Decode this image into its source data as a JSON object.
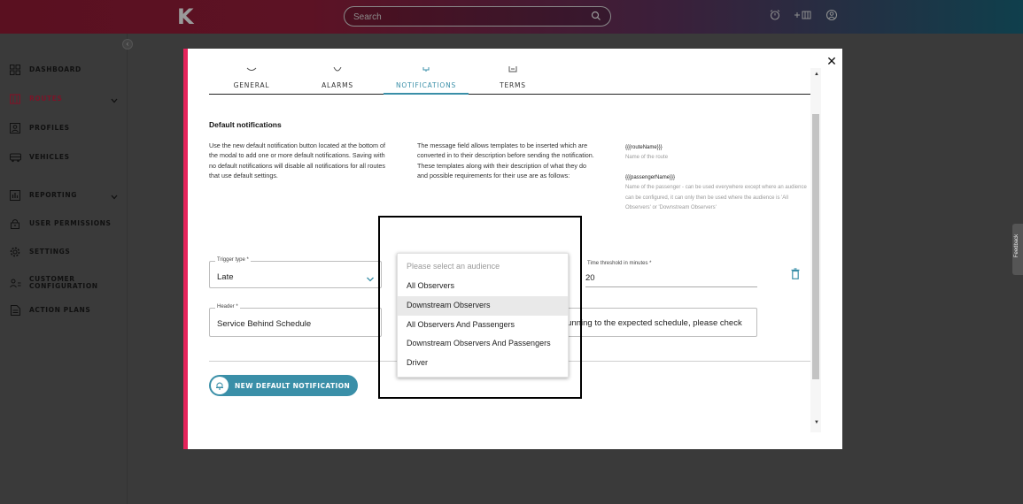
{
  "topbar": {
    "logo_text": "K",
    "search_placeholder": "Search"
  },
  "sidebar": {
    "items": [
      {
        "label": "DASHBOARD",
        "icon": "dashboard-icon"
      },
      {
        "label": "ROUTES",
        "icon": "routes-icon",
        "active": true,
        "expandable": true
      },
      {
        "label": "PROFILES",
        "icon": "profile-icon"
      },
      {
        "label": "VEHICLES",
        "icon": "vehicle-icon"
      },
      {
        "label": "REPORTING",
        "icon": "reporting-icon",
        "expandable": true
      },
      {
        "label": "USER PERMISSIONS",
        "icon": "lock-icon"
      },
      {
        "label": "SETTINGS",
        "icon": "gear-icon"
      },
      {
        "label": "CUSTOMER CONFIGURATION",
        "icon": "users-icon"
      },
      {
        "label": "ACTION PLANS",
        "icon": "document-icon"
      }
    ]
  },
  "modal": {
    "tabs": [
      {
        "label": "GENERAL",
        "icon": "general-icon"
      },
      {
        "label": "ALARMS",
        "icon": "alarm-icon"
      },
      {
        "label": "NOTIFICATIONS",
        "icon": "bell-icon",
        "active": true
      },
      {
        "label": "TERMS",
        "icon": "terms-icon"
      }
    ],
    "section_title": "Default notifications",
    "description": "Use the new default notification button located at the bottom of the modal to add one or more default notifications. Saving with no default notifications will disable all notifications for all routes that use default settings.",
    "template_help": "The message field allows templates to be inserted which are converted in to their description before sending the notification. These templates along with their description of what they do and possible requirements for their use are as follows:",
    "templates": [
      {
        "key": "{{{routeName}}}",
        "description": "Name of the route"
      },
      {
        "key": "{{{passengerName}}}",
        "description": "Name of the passenger - can be used everywhere except where an audience can be configured, it can only then be used where the audience is 'All Observers' or 'Downstream Observers'"
      }
    ],
    "trigger_type": {
      "label": "Trigger type *",
      "value": "Late"
    },
    "threshold": {
      "label": "Time threshold in minutes *",
      "value": "20"
    },
    "header": {
      "label": "Header *",
      "value": "Service Behind Schedule"
    },
    "message_visible": "running to the expected schedule, please check",
    "new_button_label": "NEW DEFAULT NOTIFICATION",
    "audience_dropdown": {
      "placeholder": "Please select an audience",
      "options": [
        "All Observers",
        "Downstream Observers",
        "All Observers And Passengers",
        "Downstream Observers And Passengers",
        "Driver"
      ],
      "highlighted": "Downstream Observers"
    }
  },
  "feedback_label": "Feedback",
  "colors": {
    "accent": "#3a8fa8",
    "modal_border": "#e4245b",
    "active_nav": "#7a1528"
  }
}
